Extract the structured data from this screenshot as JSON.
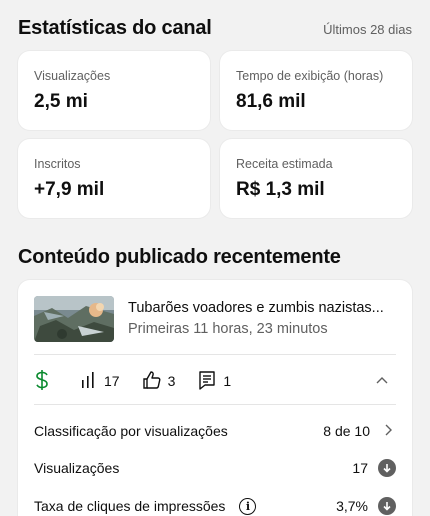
{
  "channel_stats": {
    "title": "Estatísticas do canal",
    "period": "Últimos 28 dias",
    "cards": [
      {
        "label": "Visualizações",
        "value": "2,5 mi"
      },
      {
        "label": "Tempo de exibição (horas)",
        "value": "81,6 mil"
      },
      {
        "label": "Inscritos",
        "value": "+7,9 mil"
      },
      {
        "label": "Receita estimada",
        "value": "R$ 1,3 mil"
      }
    ]
  },
  "recent": {
    "title": "Conteúdo publicado recentemente",
    "video": {
      "title": "Tubarões voadores e zumbis nazistas...",
      "subtitle": "Primeiras 11 horas, 23 minutos",
      "views_count": "17",
      "likes": "3",
      "comments": "1"
    },
    "rows": [
      {
        "label": "Classificação por visualizações",
        "value": "8 de 10"
      },
      {
        "label": "Visualizações",
        "value": "17"
      },
      {
        "label": "Taxa de cliques de impressões",
        "value": "3,7%"
      }
    ]
  },
  "colors": {
    "monetization_green": "#0a8a2e",
    "text_secondary": "#606060"
  },
  "icons": [
    "dollar-icon",
    "bar-chart-icon",
    "thumbs-up-icon",
    "comment-icon",
    "chevron-up-icon",
    "chevron-right-icon",
    "arrow-down-circle-icon",
    "info-icon"
  ]
}
